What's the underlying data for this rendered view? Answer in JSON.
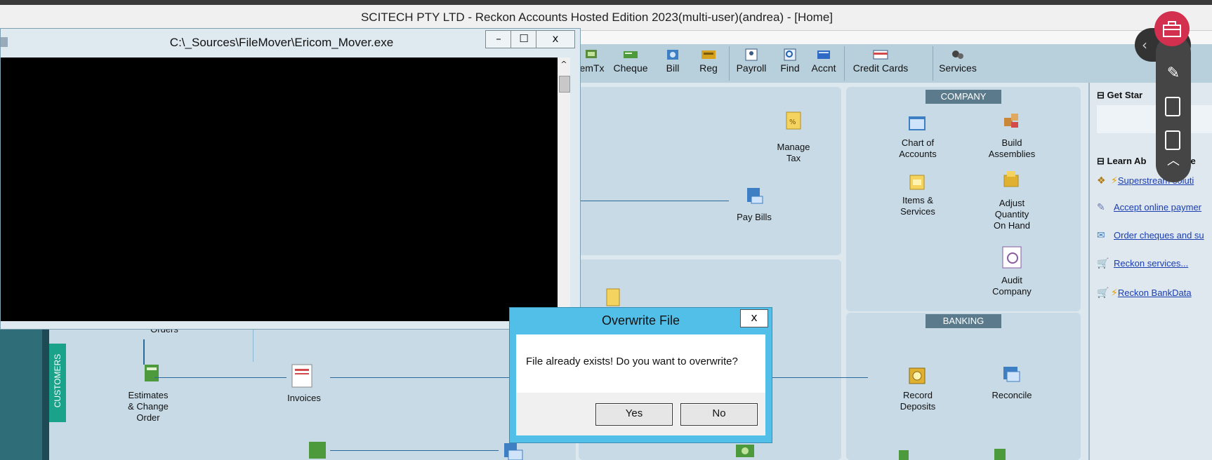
{
  "window": {
    "title": "SCITECH PTY LTD - Reckon Accounts Hosted Edition 2023(multi-user)(andrea) - [Home]"
  },
  "toolbar": {
    "items": [
      {
        "label": "emTx",
        "icon": "item-tax-icon"
      },
      {
        "label": "Cheque",
        "icon": "cheque-icon"
      },
      {
        "label": "Bill",
        "icon": "bill-icon"
      },
      {
        "label": "Reg",
        "icon": "register-icon"
      },
      {
        "label": "Payroll",
        "icon": "payroll-icon"
      },
      {
        "label": "Find",
        "icon": "find-icon"
      },
      {
        "label": "Accnt",
        "icon": "account-icon"
      },
      {
        "label": "Credit Cards",
        "icon": "credit-card-icon"
      },
      {
        "label": "Services",
        "icon": "services-icon"
      }
    ]
  },
  "home": {
    "vendors": {
      "manage_tax": "Manage\nTax",
      "pay_bills": "Pay Bills"
    },
    "company": {
      "header": "COMPANY",
      "chart_of_accounts": "Chart of\nAccounts",
      "build_assemblies": "Build\nAssemblies",
      "items_services": "Items &\nServices",
      "adjust_quantity": "Adjust\nQuantity\nOn Hand",
      "audit_company": "Audit\nCompany"
    },
    "banking": {
      "header": "BANKING",
      "record_deposits": "Record\nDeposits",
      "reconcile": "Reconcile"
    },
    "customers": {
      "tag": "CUSTOMERS",
      "orders": "Orders",
      "estimates": "Estimates\n& Change\nOrder",
      "invoices": "Invoices"
    }
  },
  "right_panel": {
    "get_started": "Get Star",
    "learn_about": "Learn Ab",
    "learn_suffix": "rvice",
    "links": [
      {
        "text": "Superstream soluti",
        "bolt": true
      },
      {
        "text": "Accept online paymer",
        "bolt": false
      },
      {
        "text": "Order cheques and su",
        "bolt": false
      },
      {
        "text": "Reckon services...",
        "bolt": false
      },
      {
        "text": "Reckon BankData",
        "bolt": true
      }
    ]
  },
  "console": {
    "title": "C:\\_Sources\\FileMover\\Ericom_Mover.exe",
    "min": "–",
    "max": "☐",
    "close": "x"
  },
  "dialog": {
    "title": "Overwrite File",
    "close": "x",
    "message": "File already exists! Do you want to overwrite?",
    "yes": "Yes",
    "no": "No"
  },
  "colors": {
    "dialog_frame": "#52bfe8",
    "customers_tag": "#1aa38a",
    "tools_red": "#d32f4f"
  }
}
